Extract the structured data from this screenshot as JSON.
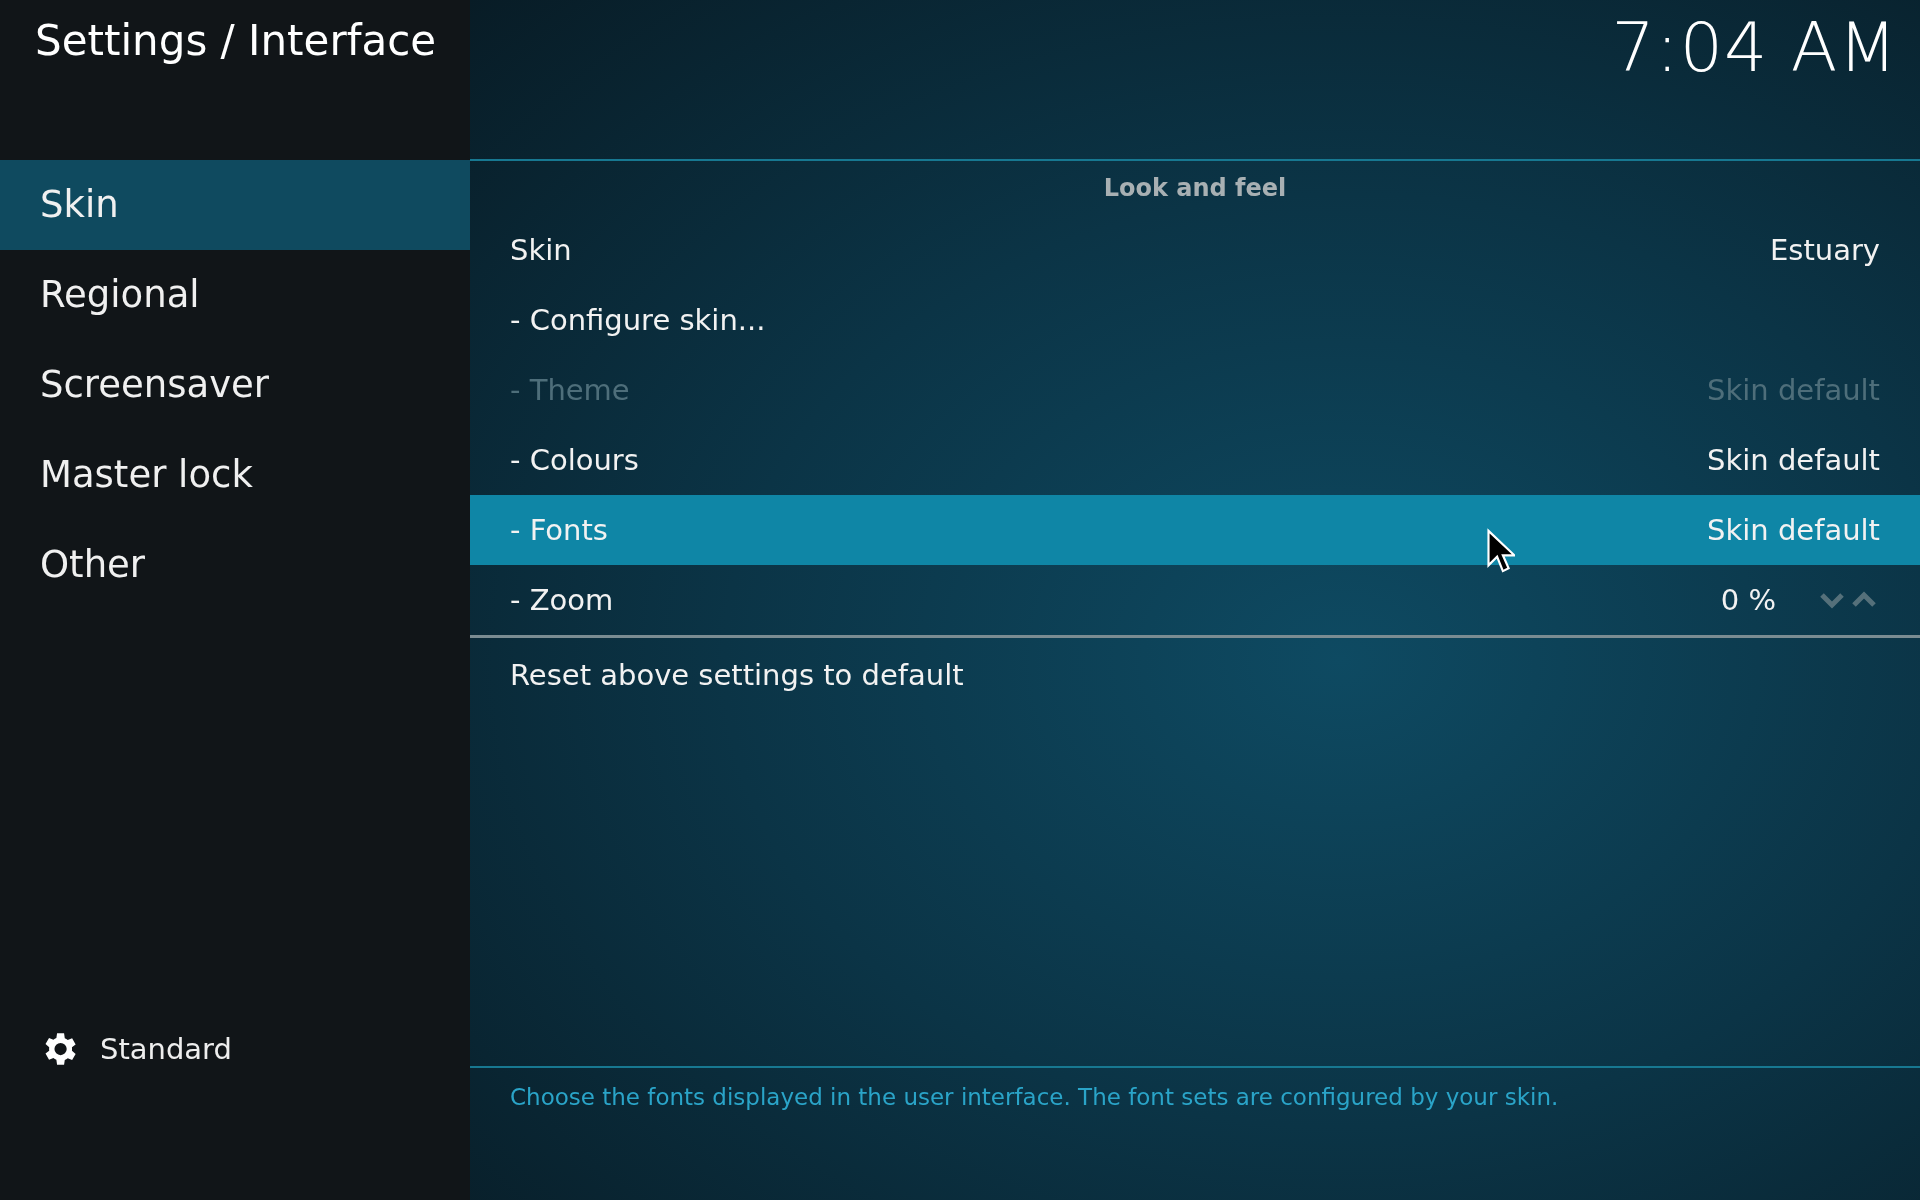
{
  "header": {
    "title": "Settings / Interface",
    "clock": "7:04 AM"
  },
  "sidebar": {
    "items": [
      {
        "label": "Skin",
        "selected": true
      },
      {
        "label": "Regional",
        "selected": false
      },
      {
        "label": "Screensaver",
        "selected": false
      },
      {
        "label": "Master lock",
        "selected": false
      },
      {
        "label": "Other",
        "selected": false
      }
    ],
    "level_label": "Standard"
  },
  "section": {
    "title": "Look and feel"
  },
  "settings": [
    {
      "kind": "value",
      "label": "Skin",
      "value": "Estuary",
      "disabled": false,
      "selected": false
    },
    {
      "kind": "action",
      "label": "- Configure skin...",
      "disabled": false,
      "selected": false
    },
    {
      "kind": "value",
      "label": "- Theme",
      "value": "Skin default",
      "disabled": true,
      "selected": false
    },
    {
      "kind": "value",
      "label": "- Colours",
      "value": "Skin default",
      "disabled": false,
      "selected": false
    },
    {
      "kind": "value",
      "label": "- Fonts",
      "value": "Skin default",
      "disabled": false,
      "selected": true
    },
    {
      "kind": "spinner",
      "label": "- Zoom",
      "value": "0 %",
      "disabled": false,
      "selected": false
    }
  ],
  "reset": {
    "label": "Reset above settings to default"
  },
  "description": "Choose the fonts displayed in the user interface. The font sets are configured by your skin."
}
